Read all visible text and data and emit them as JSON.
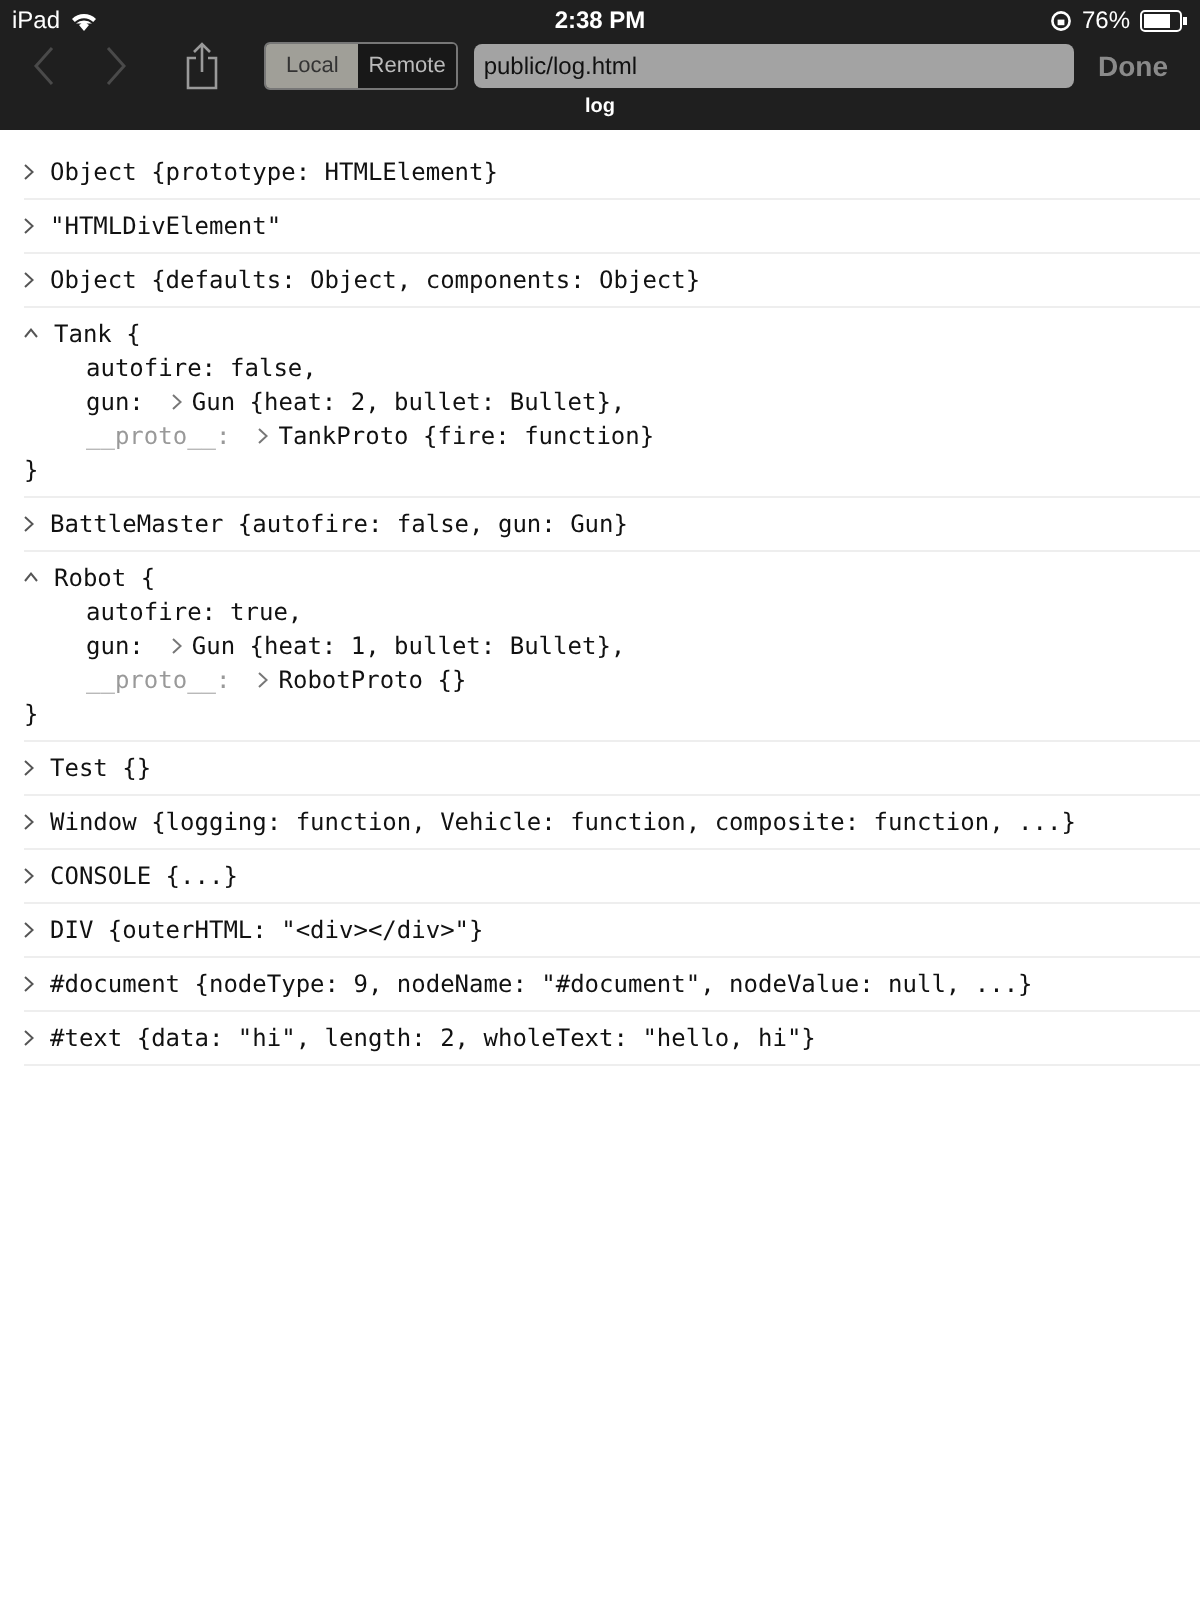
{
  "status_bar": {
    "device": "iPad",
    "time": "2:38 PM",
    "battery": "76%"
  },
  "toolbar": {
    "back_disabled": true,
    "forward_disabled": true,
    "segments": [
      {
        "label": "Local",
        "selected": true
      },
      {
        "label": "Remote",
        "selected": false
      }
    ],
    "address": "public/log.html",
    "done": "Done",
    "title": "log"
  },
  "log": [
    {
      "expanded": false,
      "text": "Object {prototype: HTMLElement}"
    },
    {
      "expanded": false,
      "text": "\"HTMLDivElement\""
    },
    {
      "expanded": false,
      "text": "Object {defaults: Object, components: Object}"
    },
    {
      "expanded": true,
      "text": "Tank {",
      "closing": "}",
      "properties": [
        {
          "key": "autofire:",
          "dim": false,
          "expandable": false,
          "value": "false,"
        },
        {
          "key": "gun:",
          "dim": false,
          "expandable": true,
          "value": "Gun {heat: 2, bullet: Bullet},"
        },
        {
          "key": "__proto__:",
          "dim": true,
          "expandable": true,
          "value": "TankProto {fire: function}"
        }
      ]
    },
    {
      "expanded": false,
      "text": "BattleMaster {autofire: false, gun: Gun}"
    },
    {
      "expanded": true,
      "text": "Robot {",
      "closing": "}",
      "properties": [
        {
          "key": "autofire:",
          "dim": false,
          "expandable": false,
          "value": "true,"
        },
        {
          "key": "gun:",
          "dim": false,
          "expandable": true,
          "value": "Gun {heat: 1, bullet: Bullet},"
        },
        {
          "key": "__proto__:",
          "dim": true,
          "expandable": true,
          "value": "RobotProto {}"
        }
      ]
    },
    {
      "expanded": false,
      "text": "Test {}"
    },
    {
      "expanded": false,
      "text": "Window {logging: function, Vehicle: function, composite: function, ...}"
    },
    {
      "expanded": false,
      "text": "CONSOLE {...}"
    },
    {
      "expanded": false,
      "text": "DIV {outerHTML: \"<div></div>\"}"
    },
    {
      "expanded": false,
      "text": "#document {nodeType: 9, nodeName: \"#document\", nodeValue: null, ...}"
    },
    {
      "expanded": false,
      "text": "#text {data: \"hi\", length: 2, wholeText: \"hello, hi\"}"
    }
  ]
}
